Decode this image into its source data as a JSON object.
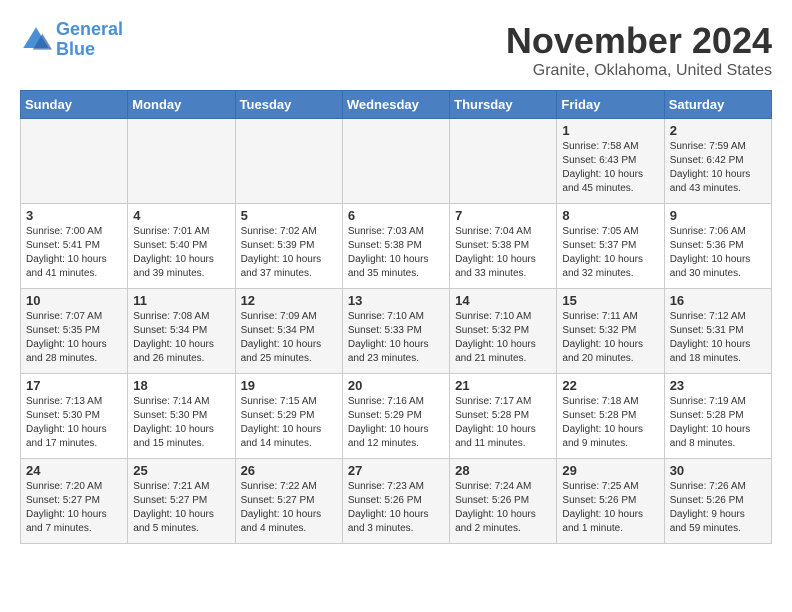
{
  "header": {
    "logo": {
      "line1": "General",
      "line2": "Blue"
    },
    "month": "November 2024",
    "location": "Granite, Oklahoma, United States"
  },
  "weekdays": [
    "Sunday",
    "Monday",
    "Tuesday",
    "Wednesday",
    "Thursday",
    "Friday",
    "Saturday"
  ],
  "weeks": [
    [
      {
        "day": "",
        "info": ""
      },
      {
        "day": "",
        "info": ""
      },
      {
        "day": "",
        "info": ""
      },
      {
        "day": "",
        "info": ""
      },
      {
        "day": "",
        "info": ""
      },
      {
        "day": "1",
        "info": "Sunrise: 7:58 AM\nSunset: 6:43 PM\nDaylight: 10 hours\nand 45 minutes."
      },
      {
        "day": "2",
        "info": "Sunrise: 7:59 AM\nSunset: 6:42 PM\nDaylight: 10 hours\nand 43 minutes."
      }
    ],
    [
      {
        "day": "3",
        "info": "Sunrise: 7:00 AM\nSunset: 5:41 PM\nDaylight: 10 hours\nand 41 minutes."
      },
      {
        "day": "4",
        "info": "Sunrise: 7:01 AM\nSunset: 5:40 PM\nDaylight: 10 hours\nand 39 minutes."
      },
      {
        "day": "5",
        "info": "Sunrise: 7:02 AM\nSunset: 5:39 PM\nDaylight: 10 hours\nand 37 minutes."
      },
      {
        "day": "6",
        "info": "Sunrise: 7:03 AM\nSunset: 5:38 PM\nDaylight: 10 hours\nand 35 minutes."
      },
      {
        "day": "7",
        "info": "Sunrise: 7:04 AM\nSunset: 5:38 PM\nDaylight: 10 hours\nand 33 minutes."
      },
      {
        "day": "8",
        "info": "Sunrise: 7:05 AM\nSunset: 5:37 PM\nDaylight: 10 hours\nand 32 minutes."
      },
      {
        "day": "9",
        "info": "Sunrise: 7:06 AM\nSunset: 5:36 PM\nDaylight: 10 hours\nand 30 minutes."
      }
    ],
    [
      {
        "day": "10",
        "info": "Sunrise: 7:07 AM\nSunset: 5:35 PM\nDaylight: 10 hours\nand 28 minutes."
      },
      {
        "day": "11",
        "info": "Sunrise: 7:08 AM\nSunset: 5:34 PM\nDaylight: 10 hours\nand 26 minutes."
      },
      {
        "day": "12",
        "info": "Sunrise: 7:09 AM\nSunset: 5:34 PM\nDaylight: 10 hours\nand 25 minutes."
      },
      {
        "day": "13",
        "info": "Sunrise: 7:10 AM\nSunset: 5:33 PM\nDaylight: 10 hours\nand 23 minutes."
      },
      {
        "day": "14",
        "info": "Sunrise: 7:10 AM\nSunset: 5:32 PM\nDaylight: 10 hours\nand 21 minutes."
      },
      {
        "day": "15",
        "info": "Sunrise: 7:11 AM\nSunset: 5:32 PM\nDaylight: 10 hours\nand 20 minutes."
      },
      {
        "day": "16",
        "info": "Sunrise: 7:12 AM\nSunset: 5:31 PM\nDaylight: 10 hours\nand 18 minutes."
      }
    ],
    [
      {
        "day": "17",
        "info": "Sunrise: 7:13 AM\nSunset: 5:30 PM\nDaylight: 10 hours\nand 17 minutes."
      },
      {
        "day": "18",
        "info": "Sunrise: 7:14 AM\nSunset: 5:30 PM\nDaylight: 10 hours\nand 15 minutes."
      },
      {
        "day": "19",
        "info": "Sunrise: 7:15 AM\nSunset: 5:29 PM\nDaylight: 10 hours\nand 14 minutes."
      },
      {
        "day": "20",
        "info": "Sunrise: 7:16 AM\nSunset: 5:29 PM\nDaylight: 10 hours\nand 12 minutes."
      },
      {
        "day": "21",
        "info": "Sunrise: 7:17 AM\nSunset: 5:28 PM\nDaylight: 10 hours\nand 11 minutes."
      },
      {
        "day": "22",
        "info": "Sunrise: 7:18 AM\nSunset: 5:28 PM\nDaylight: 10 hours\nand 9 minutes."
      },
      {
        "day": "23",
        "info": "Sunrise: 7:19 AM\nSunset: 5:28 PM\nDaylight: 10 hours\nand 8 minutes."
      }
    ],
    [
      {
        "day": "24",
        "info": "Sunrise: 7:20 AM\nSunset: 5:27 PM\nDaylight: 10 hours\nand 7 minutes."
      },
      {
        "day": "25",
        "info": "Sunrise: 7:21 AM\nSunset: 5:27 PM\nDaylight: 10 hours\nand 5 minutes."
      },
      {
        "day": "26",
        "info": "Sunrise: 7:22 AM\nSunset: 5:27 PM\nDaylight: 10 hours\nand 4 minutes."
      },
      {
        "day": "27",
        "info": "Sunrise: 7:23 AM\nSunset: 5:26 PM\nDaylight: 10 hours\nand 3 minutes."
      },
      {
        "day": "28",
        "info": "Sunrise: 7:24 AM\nSunset: 5:26 PM\nDaylight: 10 hours\nand 2 minutes."
      },
      {
        "day": "29",
        "info": "Sunrise: 7:25 AM\nSunset: 5:26 PM\nDaylight: 10 hours\nand 1 minute."
      },
      {
        "day": "30",
        "info": "Sunrise: 7:26 AM\nSunset: 5:26 PM\nDaylight: 9 hours\nand 59 minutes."
      }
    ]
  ]
}
